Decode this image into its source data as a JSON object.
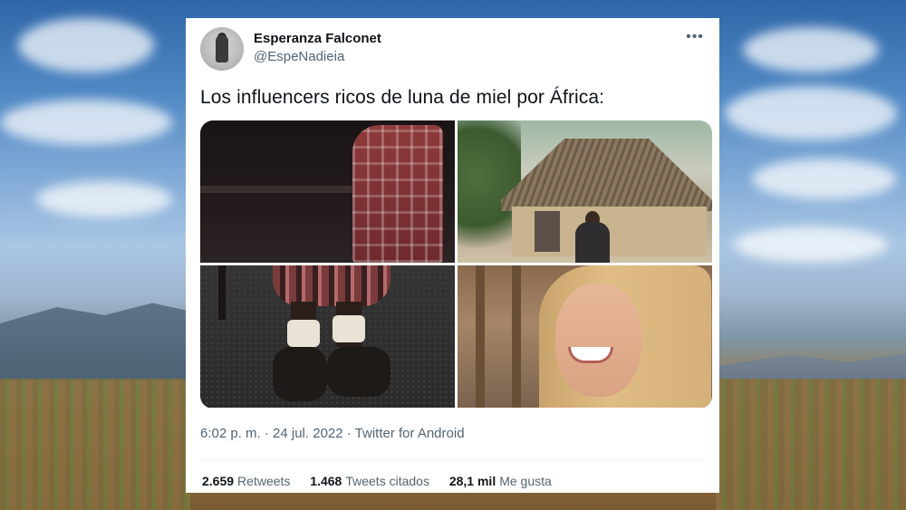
{
  "tweet": {
    "display_name": "Esperanza Falconet",
    "handle": "@EspeNadieia",
    "more_icon": "more-horizontal-icon",
    "text": "Los influencers ricos de luna de miel por África:",
    "timestamp": "6:02 p. m. · 24 jul. 2022 · Twitter for Android",
    "stats": {
      "retweets_count": "2.659",
      "retweets_label": "Retweets",
      "quotes_count": "1.468",
      "quotes_label": "Tweets citados",
      "likes_count": "28,1 mil",
      "likes_label": "Me gusta"
    }
  },
  "colors": {
    "text_primary": "#0f1419",
    "text_secondary": "#536471",
    "card_bg": "#ffffff",
    "divider": "#eff3f4"
  }
}
